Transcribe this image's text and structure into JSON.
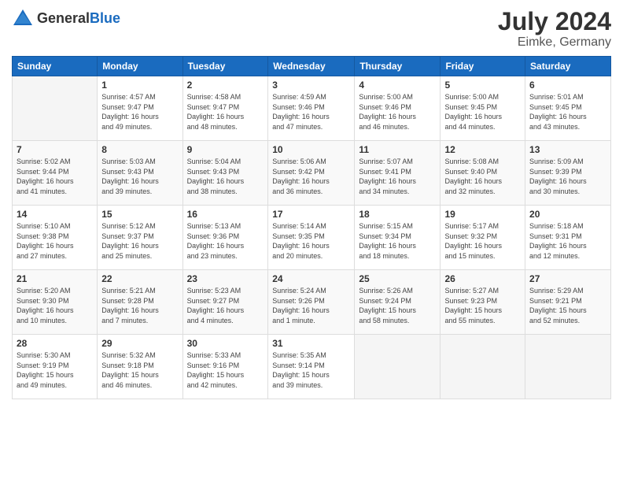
{
  "header": {
    "logo_general": "General",
    "logo_blue": "Blue",
    "month_year": "July 2024",
    "location": "Eimke, Germany"
  },
  "days_of_week": [
    "Sunday",
    "Monday",
    "Tuesday",
    "Wednesday",
    "Thursday",
    "Friday",
    "Saturday"
  ],
  "weeks": [
    [
      {
        "day": "",
        "info": ""
      },
      {
        "day": "1",
        "info": "Sunrise: 4:57 AM\nSunset: 9:47 PM\nDaylight: 16 hours\nand 49 minutes."
      },
      {
        "day": "2",
        "info": "Sunrise: 4:58 AM\nSunset: 9:47 PM\nDaylight: 16 hours\nand 48 minutes."
      },
      {
        "day": "3",
        "info": "Sunrise: 4:59 AM\nSunset: 9:46 PM\nDaylight: 16 hours\nand 47 minutes."
      },
      {
        "day": "4",
        "info": "Sunrise: 5:00 AM\nSunset: 9:46 PM\nDaylight: 16 hours\nand 46 minutes."
      },
      {
        "day": "5",
        "info": "Sunrise: 5:00 AM\nSunset: 9:45 PM\nDaylight: 16 hours\nand 44 minutes."
      },
      {
        "day": "6",
        "info": "Sunrise: 5:01 AM\nSunset: 9:45 PM\nDaylight: 16 hours\nand 43 minutes."
      }
    ],
    [
      {
        "day": "7",
        "info": "Sunrise: 5:02 AM\nSunset: 9:44 PM\nDaylight: 16 hours\nand 41 minutes."
      },
      {
        "day": "8",
        "info": "Sunrise: 5:03 AM\nSunset: 9:43 PM\nDaylight: 16 hours\nand 39 minutes."
      },
      {
        "day": "9",
        "info": "Sunrise: 5:04 AM\nSunset: 9:43 PM\nDaylight: 16 hours\nand 38 minutes."
      },
      {
        "day": "10",
        "info": "Sunrise: 5:06 AM\nSunset: 9:42 PM\nDaylight: 16 hours\nand 36 minutes."
      },
      {
        "day": "11",
        "info": "Sunrise: 5:07 AM\nSunset: 9:41 PM\nDaylight: 16 hours\nand 34 minutes."
      },
      {
        "day": "12",
        "info": "Sunrise: 5:08 AM\nSunset: 9:40 PM\nDaylight: 16 hours\nand 32 minutes."
      },
      {
        "day": "13",
        "info": "Sunrise: 5:09 AM\nSunset: 9:39 PM\nDaylight: 16 hours\nand 30 minutes."
      }
    ],
    [
      {
        "day": "14",
        "info": "Sunrise: 5:10 AM\nSunset: 9:38 PM\nDaylight: 16 hours\nand 27 minutes."
      },
      {
        "day": "15",
        "info": "Sunrise: 5:12 AM\nSunset: 9:37 PM\nDaylight: 16 hours\nand 25 minutes."
      },
      {
        "day": "16",
        "info": "Sunrise: 5:13 AM\nSunset: 9:36 PM\nDaylight: 16 hours\nand 23 minutes."
      },
      {
        "day": "17",
        "info": "Sunrise: 5:14 AM\nSunset: 9:35 PM\nDaylight: 16 hours\nand 20 minutes."
      },
      {
        "day": "18",
        "info": "Sunrise: 5:15 AM\nSunset: 9:34 PM\nDaylight: 16 hours\nand 18 minutes."
      },
      {
        "day": "19",
        "info": "Sunrise: 5:17 AM\nSunset: 9:32 PM\nDaylight: 16 hours\nand 15 minutes."
      },
      {
        "day": "20",
        "info": "Sunrise: 5:18 AM\nSunset: 9:31 PM\nDaylight: 16 hours\nand 12 minutes."
      }
    ],
    [
      {
        "day": "21",
        "info": "Sunrise: 5:20 AM\nSunset: 9:30 PM\nDaylight: 16 hours\nand 10 minutes."
      },
      {
        "day": "22",
        "info": "Sunrise: 5:21 AM\nSunset: 9:28 PM\nDaylight: 16 hours\nand 7 minutes."
      },
      {
        "day": "23",
        "info": "Sunrise: 5:23 AM\nSunset: 9:27 PM\nDaylight: 16 hours\nand 4 minutes."
      },
      {
        "day": "24",
        "info": "Sunrise: 5:24 AM\nSunset: 9:26 PM\nDaylight: 16 hours\nand 1 minute."
      },
      {
        "day": "25",
        "info": "Sunrise: 5:26 AM\nSunset: 9:24 PM\nDaylight: 15 hours\nand 58 minutes."
      },
      {
        "day": "26",
        "info": "Sunrise: 5:27 AM\nSunset: 9:23 PM\nDaylight: 15 hours\nand 55 minutes."
      },
      {
        "day": "27",
        "info": "Sunrise: 5:29 AM\nSunset: 9:21 PM\nDaylight: 15 hours\nand 52 minutes."
      }
    ],
    [
      {
        "day": "28",
        "info": "Sunrise: 5:30 AM\nSunset: 9:19 PM\nDaylight: 15 hours\nand 49 minutes."
      },
      {
        "day": "29",
        "info": "Sunrise: 5:32 AM\nSunset: 9:18 PM\nDaylight: 15 hours\nand 46 minutes."
      },
      {
        "day": "30",
        "info": "Sunrise: 5:33 AM\nSunset: 9:16 PM\nDaylight: 15 hours\nand 42 minutes."
      },
      {
        "day": "31",
        "info": "Sunrise: 5:35 AM\nSunset: 9:14 PM\nDaylight: 15 hours\nand 39 minutes."
      },
      {
        "day": "",
        "info": ""
      },
      {
        "day": "",
        "info": ""
      },
      {
        "day": "",
        "info": ""
      }
    ]
  ]
}
